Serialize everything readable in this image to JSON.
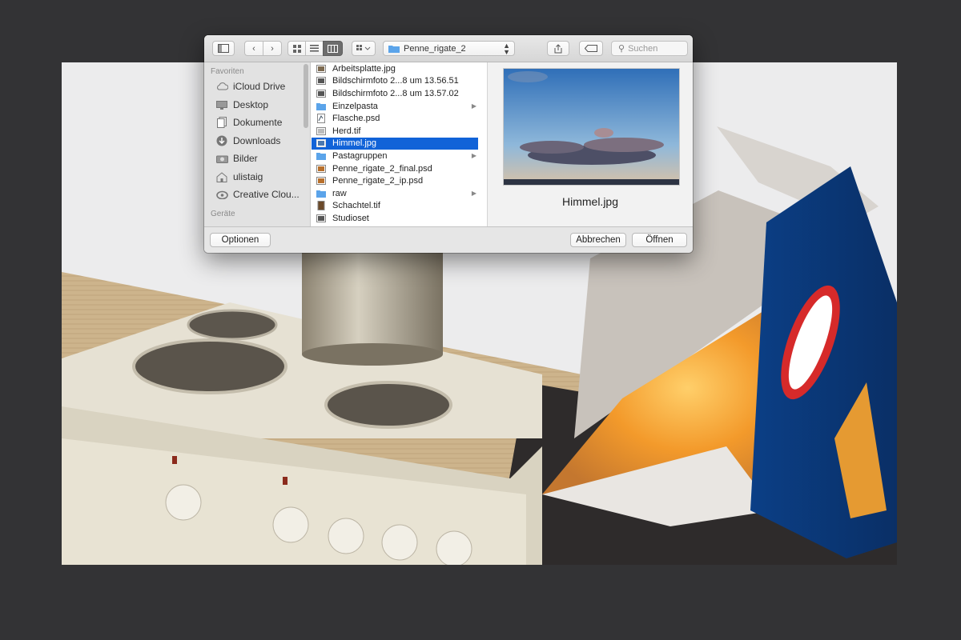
{
  "dialog": {
    "path_popup": "Penne_rigate_2",
    "search_placeholder": "Suchen",
    "sidebar": {
      "favorites_heading": "Favoriten",
      "devices_heading": "Geräte",
      "items": [
        {
          "label": "iCloud Drive",
          "icon": "cloud-icon"
        },
        {
          "label": "Desktop",
          "icon": "desktop-icon"
        },
        {
          "label": "Dokumente",
          "icon": "documents-icon"
        },
        {
          "label": "Downloads",
          "icon": "downloads-icon"
        },
        {
          "label": "Bilder",
          "icon": "camera-icon"
        },
        {
          "label": "ulistaig",
          "icon": "home-icon"
        },
        {
          "label": "Creative Clou...",
          "icon": "creative-cloud-icon"
        }
      ]
    },
    "files": [
      {
        "name": "Arbeitsplatte.jpg",
        "type": "image"
      },
      {
        "name": "Bildschirmfoto 2...8 um 13.56.51",
        "type": "screenshot"
      },
      {
        "name": "Bildschirmfoto 2...8 um 13.57.02",
        "type": "screenshot"
      },
      {
        "name": "Einzelpasta",
        "type": "folder"
      },
      {
        "name": "Flasche.psd",
        "type": "psd"
      },
      {
        "name": "Herd.tif",
        "type": "image"
      },
      {
        "name": "Himmel.jpg",
        "type": "image",
        "selected": true
      },
      {
        "name": "Pastagruppen",
        "type": "folder"
      },
      {
        "name": "Penne_rigate_2_final.psd",
        "type": "psd"
      },
      {
        "name": "Penne_rigate_2_ip.psd",
        "type": "psd"
      },
      {
        "name": "raw",
        "type": "folder"
      },
      {
        "name": "Schachtel.tif",
        "type": "image"
      },
      {
        "name": "Studioset",
        "type": "screenshot"
      }
    ],
    "preview_filename": "Himmel.jpg",
    "buttons": {
      "options": "Optionen",
      "cancel": "Abbrechen",
      "open": "Öffnen"
    }
  },
  "colors": {
    "selection": "#1163d8",
    "folder": "#5ba4ea",
    "canvas_background": "#333335"
  }
}
